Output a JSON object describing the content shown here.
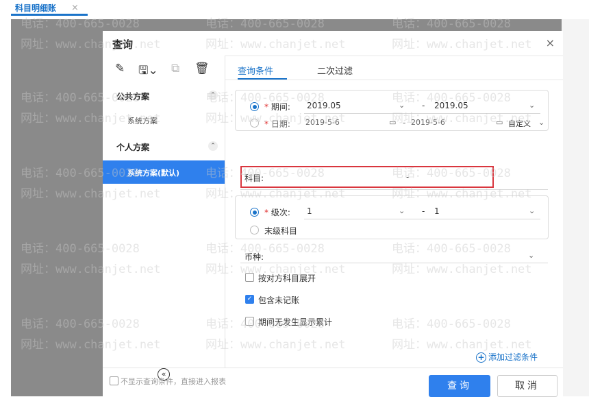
{
  "tab": {
    "label": "科目明细账",
    "close": "×"
  },
  "dialog": {
    "title": "查询",
    "close": "×",
    "toolbar": {
      "edit": "✎",
      "save": "🖫⌄",
      "export": "⧉",
      "delete": "🗑"
    },
    "left": {
      "public_section": {
        "title": "公共方案",
        "arrow": "⌃",
        "items": [
          "系统方案"
        ]
      },
      "personal_section": {
        "title": "个人方案",
        "arrow": "⌃",
        "items": [
          "系统方案(默认)"
        ]
      },
      "collapse": "«"
    },
    "tabs": [
      "查询条件",
      "二次过滤"
    ],
    "period_box": {
      "period": {
        "label": "期间:",
        "from": "2019.05",
        "sep": "-",
        "to": "2019.05"
      },
      "date": {
        "label": "日期:",
        "from": "2019-5-6",
        "sep": "-",
        "to": "2019-5-6",
        "custom": "自定义"
      }
    },
    "subject": {
      "label": "科目:",
      "sep": "-"
    },
    "level_box": {
      "level": {
        "label": "级次:",
        "from": "1",
        "sep": "-",
        "to": "1"
      },
      "leaf": "末级科目"
    },
    "currency": {
      "label": "币种:"
    },
    "checks": [
      {
        "label": "按对方科目展开",
        "checked": false
      },
      {
        "label": "包含未记账",
        "checked": true
      },
      {
        "label": "期间无发生显示累计",
        "checked": false
      }
    ],
    "add_filter": "添加过滤条件",
    "footer": {
      "note": "不显示查询条件，直接进入报表",
      "query": "查询",
      "cancel": "取消"
    }
  },
  "watermark": {
    "phone": "电话：400-665-0028",
    "site": "网址：www.chanjet.net"
  },
  "colors": {
    "accent": "#2f80ed",
    "highlight": "#d9363e",
    "overlay": "#8a8a8a"
  }
}
